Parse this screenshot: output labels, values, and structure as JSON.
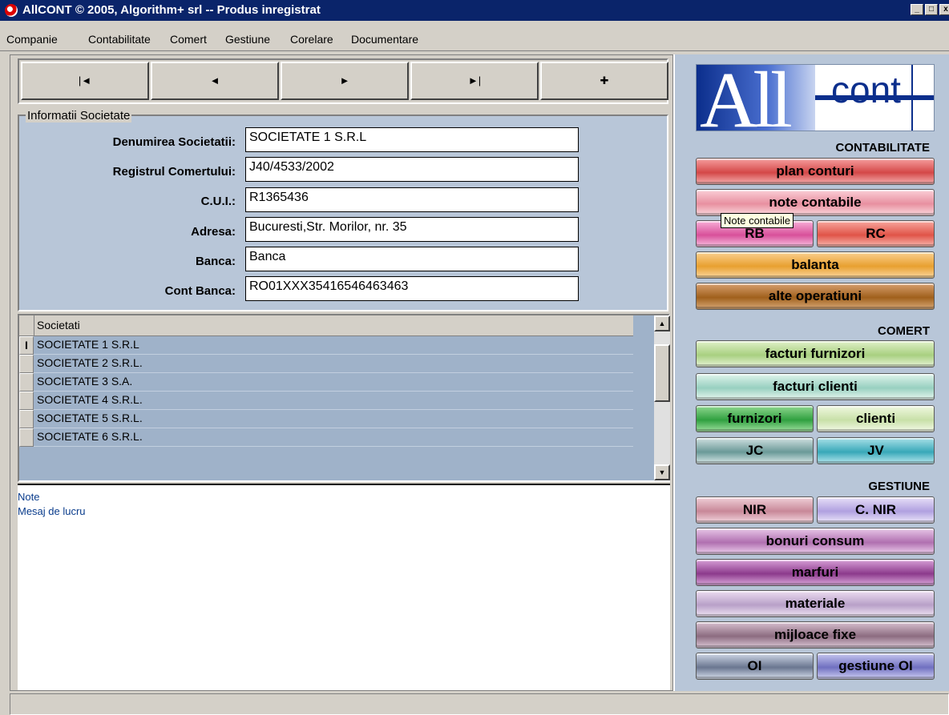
{
  "window": {
    "title": "AllCONT © 2005, Algorithm+ srl  -- Produs inregistrat"
  },
  "menu": [
    "Companie",
    "Contabilitate",
    "Comert",
    "Gestiune",
    "Corelare",
    "Documentare"
  ],
  "nav": {
    "first": "|◄",
    "prev": "◄",
    "next": "►",
    "last": "►|",
    "add": "✚"
  },
  "info": {
    "legend": "Informatii Societate",
    "fields": [
      {
        "label": "Denumirea Societatii:",
        "value": "SOCIETATE 1 S.R.L"
      },
      {
        "label": "Registrul Comertului:",
        "value": "J40/4533/2002"
      },
      {
        "label": "C.U.I.:",
        "value": "R1365436"
      },
      {
        "label": "Adresa:",
        "value": "Bucuresti,Str. Morilor, nr. 35"
      },
      {
        "label": "Banca:",
        "value": "Banca"
      },
      {
        "label": "Cont Banca:",
        "value": "RO01XXX35416546463463"
      }
    ]
  },
  "grid": {
    "header": "Societati",
    "rows": [
      "SOCIETATE 1 S.R.L",
      "SOCIETATE 2 S.R.L.",
      "SOCIETATE 3 S.A.",
      "SOCIETATE 4 S.R.L.",
      "SOCIETATE 5 S.R.L.",
      "SOCIETATE 6 S.R.L."
    ],
    "current_marker": "I"
  },
  "notes": {
    "line1": "Note",
    "line2": "Mesaj de lucru"
  },
  "logo": {
    "left": "All",
    "right": "cont"
  },
  "sections": {
    "contabilitate": "CONTABILITATE",
    "comert": "COMERT",
    "gestiune": "GESTIUNE"
  },
  "buttons": {
    "plan_conturi": "plan conturi",
    "note_contabile": "note contabile",
    "rb": "RB",
    "rc": "RC",
    "balanta": "balanta",
    "alte_operatiuni": "alte operatiuni",
    "facturi_furnizori": "facturi furnizori",
    "facturi_clienti": "facturi clienti",
    "furnizori": "furnizori",
    "clienti": "clienti",
    "jc": "JC",
    "jv": "JV",
    "nir": "NIR",
    "c_nir": "C. NIR",
    "bonuri_consum": "bonuri consum",
    "marfuri": "marfuri",
    "materiale": "materiale",
    "mijloace_fixe": "mijloace fixe",
    "oi": "OI",
    "gestiune_oi": "gestiune OI"
  },
  "tooltip": "Note contabile",
  "colors": {
    "title_bar": "#0a246a",
    "right_panel": "#b8c6d8",
    "grid_row": "#9fb2c9"
  }
}
